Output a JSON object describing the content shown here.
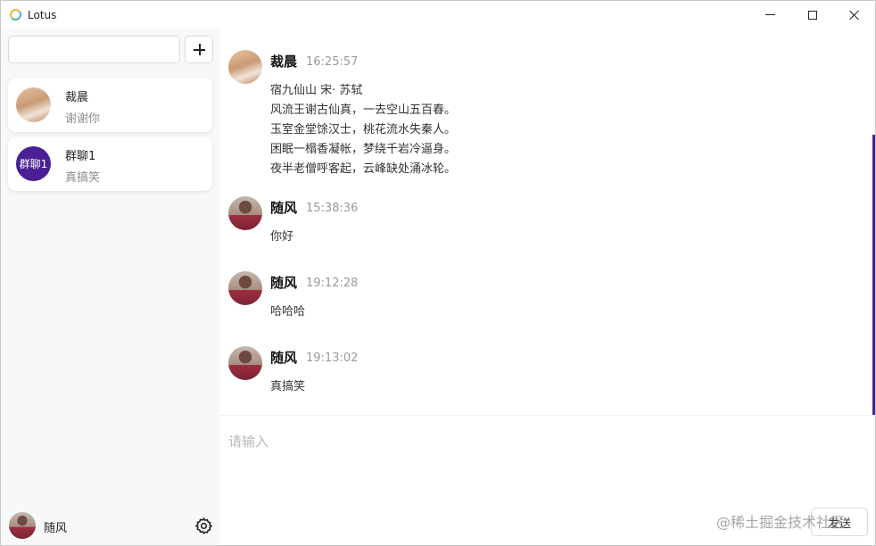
{
  "window": {
    "title": "Lotus",
    "controls": [
      "minimize-icon",
      "maximize-icon",
      "close-icon"
    ]
  },
  "sidebar": {
    "search": {
      "value": "",
      "placeholder": ""
    },
    "add_icon": "plus-icon",
    "conversations": [
      {
        "name": "裁晨",
        "preview": "谢谢你",
        "avatar": "photo"
      },
      {
        "name": "群聊1",
        "preview": "真搞笑",
        "avatar_text": "群聊1"
      }
    ],
    "current_user": {
      "name": "随风"
    },
    "settings_icon": "gear-icon"
  },
  "chat": {
    "messages": [
      {
        "sender": "裁晨",
        "time": "16:25:57",
        "lines": [
          "宿九仙山 宋· 苏轼",
          "风流王谢古仙真，一去空山五百春。",
          "玉室金堂馀汉士，桃花流水失秦人。",
          "困眠一榻香凝帐，梦绕千岩冷逼身。",
          "夜半老僧呼客起，云峰缺处涌冰轮。"
        ]
      },
      {
        "sender": "随风",
        "time": "15:38:36",
        "lines": [
          "你好"
        ]
      },
      {
        "sender": "随风",
        "time": "19:12:28",
        "lines": [
          "哈哈哈"
        ]
      },
      {
        "sender": "随风",
        "time": "19:13:02",
        "lines": [
          "真搞笑"
        ]
      }
    ],
    "scrollbar_color": "#4b1f96"
  },
  "composer": {
    "placeholder": "请输入",
    "send_label": "发送",
    "watermark": "@稀土掘金技术社区"
  },
  "colors": {
    "accent": "#4b1f96",
    "sidebar_bg": "#f7f8fa"
  }
}
